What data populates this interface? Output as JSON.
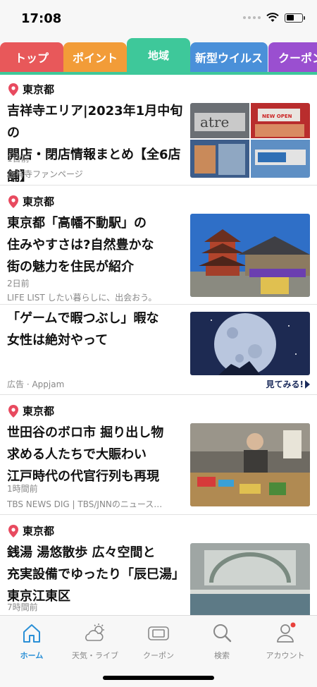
{
  "status": {
    "time": "17:08"
  },
  "tabs": [
    {
      "label": "トップ",
      "color": "#e8585a"
    },
    {
      "label": "ポイント",
      "color": "#f29c38"
    },
    {
      "label": "地域",
      "color": "#3ec89a"
    },
    {
      "label": "新型ウイルス",
      "color": "#4a90d9"
    },
    {
      "label": "クーポン",
      "color": "#9a4fd0"
    }
  ],
  "feed": [
    {
      "location": "東京都",
      "title": [
        "吉祥寺エリア|2023年1月中旬の",
        "開店・閉店情報まとめ【全6店舗】"
      ],
      "age": "1日前",
      "source": "吉祥寺ファンページ"
    },
    {
      "location": "東京都",
      "title": [
        "東京都「高幡不動駅」の",
        "住みやすさは?自然豊かな",
        "街の魅力を住民が紹介"
      ],
      "age": "2日前",
      "source": "LIFE LIST したい暮らしに、出会おう。"
    },
    {
      "title": [
        "「ゲームで暇つぶし」暇な",
        "女性は絶対やって"
      ],
      "sponsor": "広告 · Appjam",
      "cta": "見てみる!"
    },
    {
      "location": "東京都",
      "title": [
        "世田谷のボロ市 掘り出し物",
        "求める人たちで大賑わい",
        "江戸時代の代官行列も再現"
      ],
      "age": "1時間前",
      "source": "TBS NEWS DIG | TBS/JNNのニュース…"
    },
    {
      "location": "東京都",
      "title": [
        "銭湯 湯悠散歩 広々空間と",
        "充実設備でゆったり「辰巳湯」",
        "東京江東区"
      ],
      "age": "7時間前"
    }
  ],
  "thumbs": {
    "atre_logo": "atre",
    "new_open": "NEW OPEN"
  },
  "nav": [
    {
      "label": "ホーム",
      "icon": "home-icon",
      "active": true
    },
    {
      "label": "天気・ライブ",
      "icon": "weather-icon"
    },
    {
      "label": "クーポン",
      "icon": "coupon-icon"
    },
    {
      "label": "検索",
      "icon": "search-icon"
    },
    {
      "label": "アカウント",
      "icon": "account-icon",
      "badge": true
    }
  ],
  "colors": {
    "accent": "#2a8fd6",
    "pin": "#e84a5f",
    "region_tab": "#3ec89a"
  }
}
